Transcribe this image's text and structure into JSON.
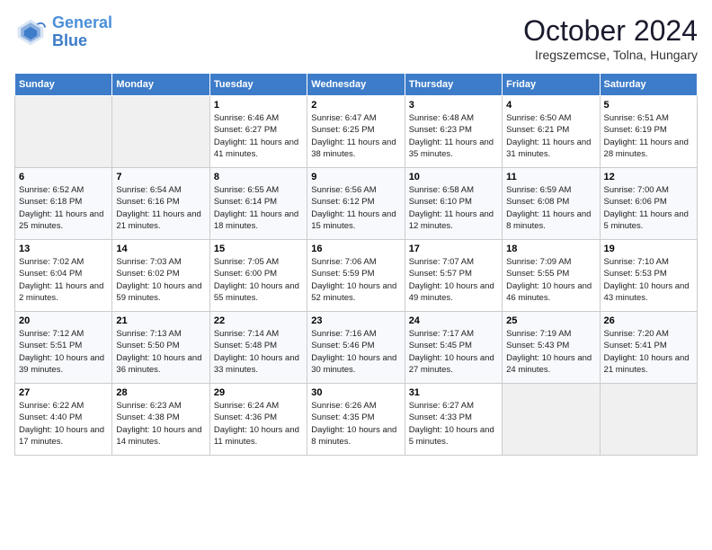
{
  "header": {
    "logo_line1": "General",
    "logo_line2": "Blue",
    "month_year": "October 2024",
    "location": "Iregszemcse, Tolna, Hungary"
  },
  "columns": [
    "Sunday",
    "Monday",
    "Tuesday",
    "Wednesday",
    "Thursday",
    "Friday",
    "Saturday"
  ],
  "weeks": [
    [
      {
        "day": "",
        "info": ""
      },
      {
        "day": "",
        "info": ""
      },
      {
        "day": "1",
        "info": "Sunrise: 6:46 AM\nSunset: 6:27 PM\nDaylight: 11 hours and 41 minutes."
      },
      {
        "day": "2",
        "info": "Sunrise: 6:47 AM\nSunset: 6:25 PM\nDaylight: 11 hours and 38 minutes."
      },
      {
        "day": "3",
        "info": "Sunrise: 6:48 AM\nSunset: 6:23 PM\nDaylight: 11 hours and 35 minutes."
      },
      {
        "day": "4",
        "info": "Sunrise: 6:50 AM\nSunset: 6:21 PM\nDaylight: 11 hours and 31 minutes."
      },
      {
        "day": "5",
        "info": "Sunrise: 6:51 AM\nSunset: 6:19 PM\nDaylight: 11 hours and 28 minutes."
      }
    ],
    [
      {
        "day": "6",
        "info": "Sunrise: 6:52 AM\nSunset: 6:18 PM\nDaylight: 11 hours and 25 minutes."
      },
      {
        "day": "7",
        "info": "Sunrise: 6:54 AM\nSunset: 6:16 PM\nDaylight: 11 hours and 21 minutes."
      },
      {
        "day": "8",
        "info": "Sunrise: 6:55 AM\nSunset: 6:14 PM\nDaylight: 11 hours and 18 minutes."
      },
      {
        "day": "9",
        "info": "Sunrise: 6:56 AM\nSunset: 6:12 PM\nDaylight: 11 hours and 15 minutes."
      },
      {
        "day": "10",
        "info": "Sunrise: 6:58 AM\nSunset: 6:10 PM\nDaylight: 11 hours and 12 minutes."
      },
      {
        "day": "11",
        "info": "Sunrise: 6:59 AM\nSunset: 6:08 PM\nDaylight: 11 hours and 8 minutes."
      },
      {
        "day": "12",
        "info": "Sunrise: 7:00 AM\nSunset: 6:06 PM\nDaylight: 11 hours and 5 minutes."
      }
    ],
    [
      {
        "day": "13",
        "info": "Sunrise: 7:02 AM\nSunset: 6:04 PM\nDaylight: 11 hours and 2 minutes."
      },
      {
        "day": "14",
        "info": "Sunrise: 7:03 AM\nSunset: 6:02 PM\nDaylight: 10 hours and 59 minutes."
      },
      {
        "day": "15",
        "info": "Sunrise: 7:05 AM\nSunset: 6:00 PM\nDaylight: 10 hours and 55 minutes."
      },
      {
        "day": "16",
        "info": "Sunrise: 7:06 AM\nSunset: 5:59 PM\nDaylight: 10 hours and 52 minutes."
      },
      {
        "day": "17",
        "info": "Sunrise: 7:07 AM\nSunset: 5:57 PM\nDaylight: 10 hours and 49 minutes."
      },
      {
        "day": "18",
        "info": "Sunrise: 7:09 AM\nSunset: 5:55 PM\nDaylight: 10 hours and 46 minutes."
      },
      {
        "day": "19",
        "info": "Sunrise: 7:10 AM\nSunset: 5:53 PM\nDaylight: 10 hours and 43 minutes."
      }
    ],
    [
      {
        "day": "20",
        "info": "Sunrise: 7:12 AM\nSunset: 5:51 PM\nDaylight: 10 hours and 39 minutes."
      },
      {
        "day": "21",
        "info": "Sunrise: 7:13 AM\nSunset: 5:50 PM\nDaylight: 10 hours and 36 minutes."
      },
      {
        "day": "22",
        "info": "Sunrise: 7:14 AM\nSunset: 5:48 PM\nDaylight: 10 hours and 33 minutes."
      },
      {
        "day": "23",
        "info": "Sunrise: 7:16 AM\nSunset: 5:46 PM\nDaylight: 10 hours and 30 minutes."
      },
      {
        "day": "24",
        "info": "Sunrise: 7:17 AM\nSunset: 5:45 PM\nDaylight: 10 hours and 27 minutes."
      },
      {
        "day": "25",
        "info": "Sunrise: 7:19 AM\nSunset: 5:43 PM\nDaylight: 10 hours and 24 minutes."
      },
      {
        "day": "26",
        "info": "Sunrise: 7:20 AM\nSunset: 5:41 PM\nDaylight: 10 hours and 21 minutes."
      }
    ],
    [
      {
        "day": "27",
        "info": "Sunrise: 6:22 AM\nSunset: 4:40 PM\nDaylight: 10 hours and 17 minutes."
      },
      {
        "day": "28",
        "info": "Sunrise: 6:23 AM\nSunset: 4:38 PM\nDaylight: 10 hours and 14 minutes."
      },
      {
        "day": "29",
        "info": "Sunrise: 6:24 AM\nSunset: 4:36 PM\nDaylight: 10 hours and 11 minutes."
      },
      {
        "day": "30",
        "info": "Sunrise: 6:26 AM\nSunset: 4:35 PM\nDaylight: 10 hours and 8 minutes."
      },
      {
        "day": "31",
        "info": "Sunrise: 6:27 AM\nSunset: 4:33 PM\nDaylight: 10 hours and 5 minutes."
      },
      {
        "day": "",
        "info": ""
      },
      {
        "day": "",
        "info": ""
      }
    ]
  ]
}
